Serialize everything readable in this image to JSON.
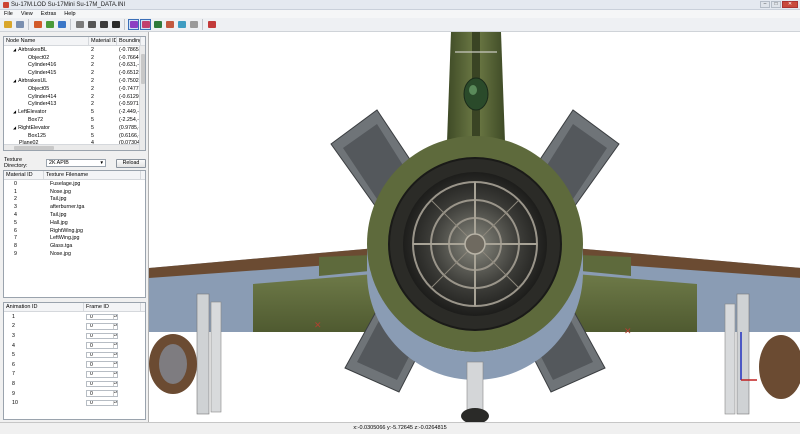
{
  "window": {
    "title": "Su-17M.LOD   Su-17Mini   Su-17M_DATA.INI",
    "minimize": "–",
    "maximize": "□",
    "close": "✕"
  },
  "menu": [
    "File",
    "View",
    "Extras",
    "Help"
  ],
  "toolbar": {
    "icons": [
      {
        "name": "open-icon",
        "color": "#d9a62a"
      },
      {
        "name": "save-icon",
        "color": "#7a8fb0"
      },
      {
        "name": "sep"
      },
      {
        "name": "rotate-icon",
        "color": "#d25b2a"
      },
      {
        "name": "move-icon",
        "color": "#4a9a3a"
      },
      {
        "name": "scale-icon",
        "color": "#3a76c7"
      },
      {
        "name": "sep"
      },
      {
        "name": "box-icon",
        "color": "#7a7a7a"
      },
      {
        "name": "solid-icon",
        "color": "#555555"
      },
      {
        "name": "shaded-icon",
        "color": "#3d3d3d"
      },
      {
        "name": "textured-icon",
        "color": "#2b2b2b"
      },
      {
        "name": "sep"
      },
      {
        "name": "mode-a-icon",
        "color": "#8d3fc2",
        "active": true
      },
      {
        "name": "mode-b-icon",
        "color": "#c23f6e",
        "active": true
      },
      {
        "name": "mode-c-icon",
        "color": "#2e7a3a"
      },
      {
        "name": "mode-d-icon",
        "color": "#c2593f"
      },
      {
        "name": "mode-e-icon",
        "color": "#3f9dc2"
      },
      {
        "name": "grid-icon",
        "color": "#9a9a9a"
      },
      {
        "name": "sep"
      },
      {
        "name": "tools-icon",
        "color": "#c23a3a"
      }
    ]
  },
  "node_tree": {
    "headers": [
      "Node Name",
      "Material ID",
      "Bounding"
    ],
    "rows": [
      {
        "name": "AirbrakesBL",
        "mat": "2",
        "bound": "(-0.7865,-",
        "indent": 1,
        "expander": "◢"
      },
      {
        "name": "Object02",
        "mat": "2",
        "bound": "(-0.7664,-",
        "indent": 2,
        "expander": ""
      },
      {
        "name": "Cylinder416",
        "mat": "2",
        "bound": "(-0.631,-3",
        "indent": 2,
        "expander": ""
      },
      {
        "name": "Cylinder415",
        "mat": "2",
        "bound": "(-0.6512,-",
        "indent": 2,
        "expander": ""
      },
      {
        "name": "AirbrakesUL",
        "mat": "2",
        "bound": "(-0.7502,-",
        "indent": 1,
        "expander": "◢"
      },
      {
        "name": "Object05",
        "mat": "2",
        "bound": "(-0.7477,-",
        "indent": 2,
        "expander": ""
      },
      {
        "name": "Cylinder414",
        "mat": "2",
        "bound": "(-0.6129,-",
        "indent": 2,
        "expander": ""
      },
      {
        "name": "Cylinder413",
        "mat": "2",
        "bound": "(-0.5971,-",
        "indent": 2,
        "expander": ""
      },
      {
        "name": "LeftElevator",
        "mat": "5",
        "bound": "(-2.449,-0",
        "indent": 1,
        "expander": "◢"
      },
      {
        "name": "Box72",
        "mat": "5",
        "bound": "(-2.254,-0",
        "indent": 2,
        "expander": ""
      },
      {
        "name": "RightElevator",
        "mat": "5",
        "bound": "(0.9785,-0",
        "indent": 1,
        "expander": "◢"
      },
      {
        "name": "Box125",
        "mat": "5",
        "bound": "(0.6166,-0",
        "indent": 2,
        "expander": ""
      },
      {
        "name": "Plane02",
        "mat": "4",
        "bound": "(0.07304,-",
        "indent": 1,
        "expander": ""
      },
      {
        "name": "Plane01",
        "mat": "4",
        "bound": "(-0.03266,",
        "indent": 1,
        "expander": ""
      }
    ]
  },
  "texture": {
    "label": "Texture Directory:",
    "selected": "2K APIB",
    "reload": "Reload"
  },
  "textures": {
    "headers": [
      "Material ID",
      "Texture Filename"
    ],
    "rows": [
      {
        "id": "0",
        "file": "Fuselage.jpg"
      },
      {
        "id": "1",
        "file": "Nose.jpg"
      },
      {
        "id": "2",
        "file": "Tail.jpg"
      },
      {
        "id": "3",
        "file": "afterburner.tga"
      },
      {
        "id": "4",
        "file": "Tail.jpg"
      },
      {
        "id": "5",
        "file": "Hall.jpg"
      },
      {
        "id": "6",
        "file": "RightWing.jpg"
      },
      {
        "id": "7",
        "file": "LeftWing.jpg"
      },
      {
        "id": "8",
        "file": "Glass.tga"
      },
      {
        "id": "9",
        "file": "Nose.jpg"
      }
    ]
  },
  "animations": {
    "headers": [
      "Animation ID",
      "Frame ID"
    ],
    "rows": [
      {
        "id": "1",
        "frame": "0"
      },
      {
        "id": "2",
        "frame": "0"
      },
      {
        "id": "3",
        "frame": "0"
      },
      {
        "id": "4",
        "frame": "0"
      },
      {
        "id": "5",
        "frame": "0"
      },
      {
        "id": "6",
        "frame": "0"
      },
      {
        "id": "7",
        "frame": "0"
      },
      {
        "id": "8",
        "frame": "0"
      },
      {
        "id": "9",
        "frame": "0"
      },
      {
        "id": "10",
        "frame": "0"
      }
    ]
  },
  "status": {
    "coords": "x:-0.0305066 y:-5.72645 z:-0.0264815"
  },
  "colors": {
    "camo_green": "#5e6a3c",
    "camo_brown": "#6b4b32",
    "metal_grey": "#6f7478",
    "under_blue": "#8a9cb4",
    "accent_red": "#b24030"
  }
}
